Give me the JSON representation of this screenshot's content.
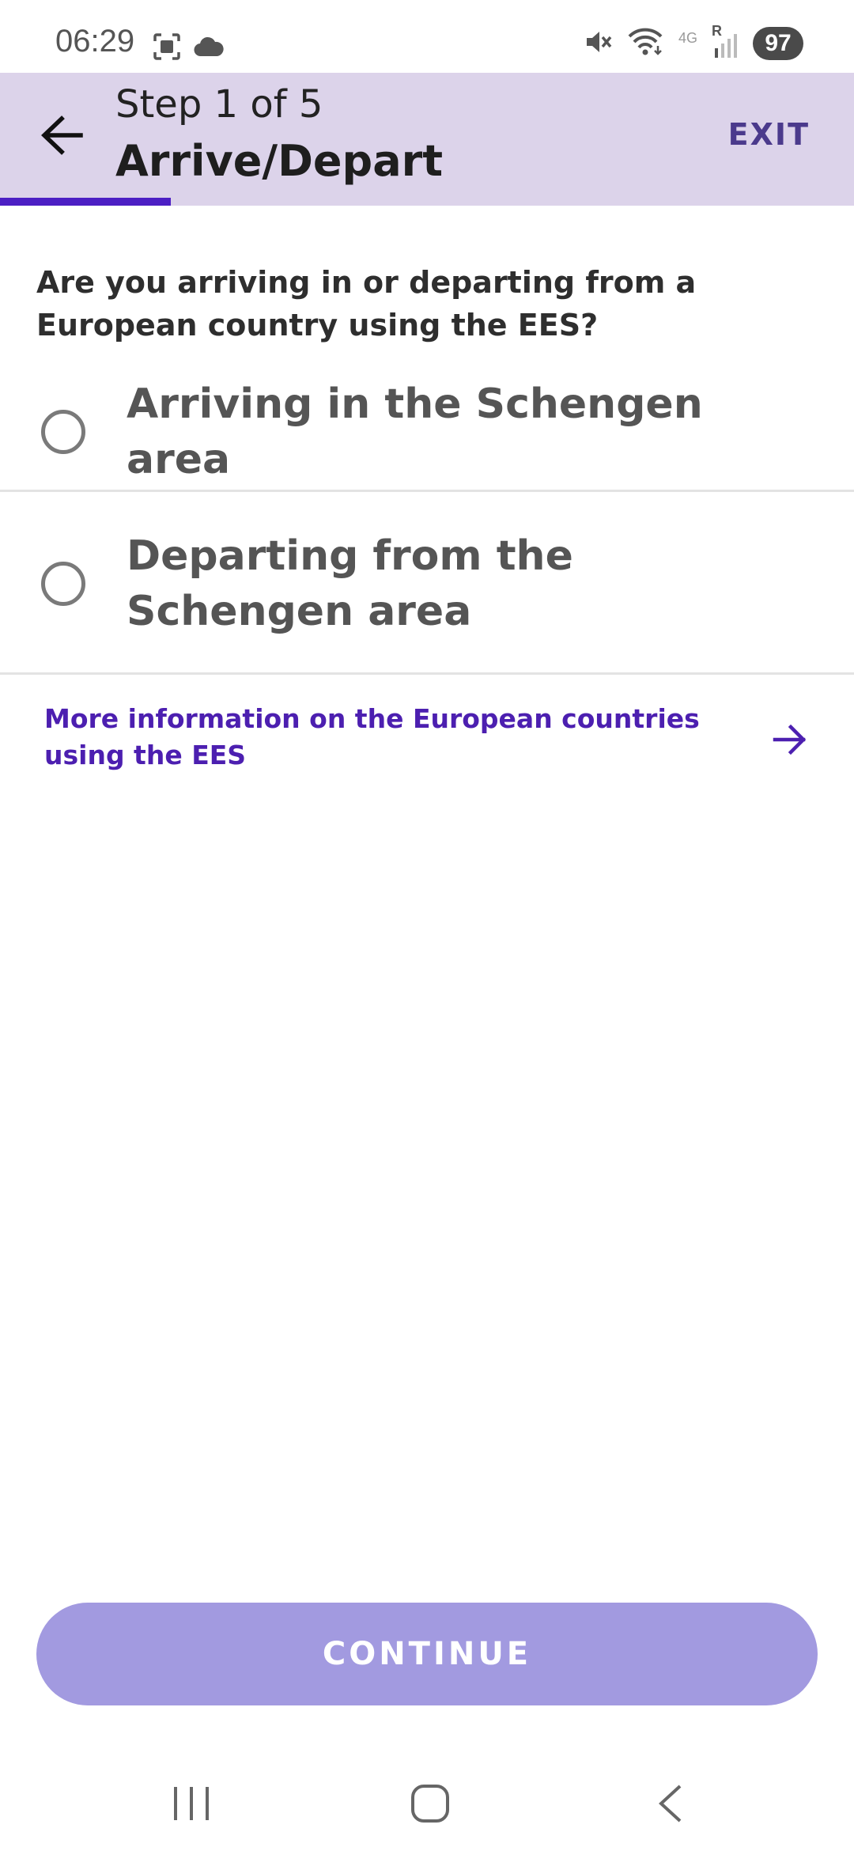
{
  "status_bar": {
    "time": "06:29",
    "network_type": "4G",
    "roaming": "R",
    "battery": "97"
  },
  "header": {
    "step": "Step 1 of 5",
    "title": "Arrive/Depart",
    "exit_label": "EXIT",
    "progress": 0.2,
    "accent_color": "#4c1fc4",
    "background_color": "#dcd3ea"
  },
  "question": "Are you arriving in or departing from a European country using the EES?",
  "options": [
    {
      "label": "Arriving in the Schengen area",
      "selected": false
    },
    {
      "label": "Departing from the Schengen area",
      "selected": false
    }
  ],
  "info_link": {
    "label": "More information on the European countries using the EES",
    "icon": "arrow-right-icon"
  },
  "continue_button": {
    "label": "CONTINUE",
    "enabled": false,
    "color": "#a29ae0"
  },
  "nav_bar": {
    "icons": [
      "recent-apps-icon",
      "home-icon",
      "back-icon"
    ]
  }
}
